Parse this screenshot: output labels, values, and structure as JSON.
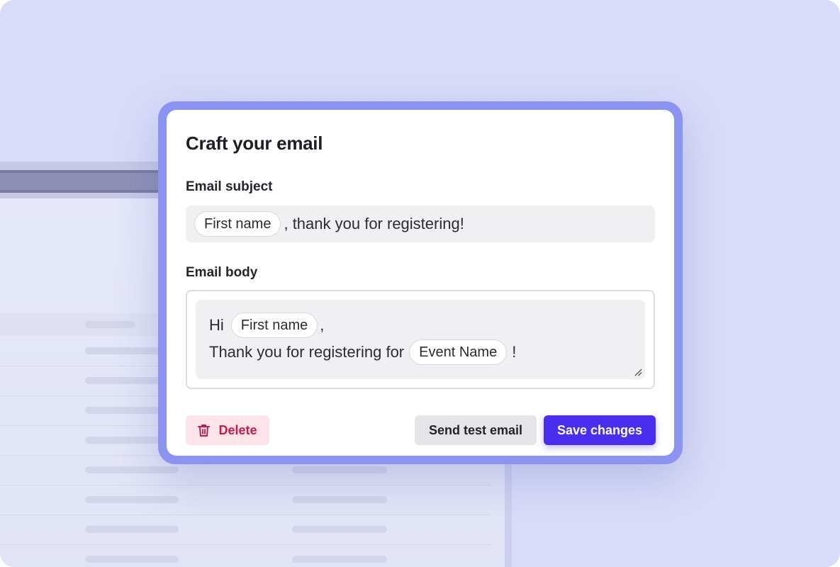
{
  "modal": {
    "title": "Craft your email",
    "subject": {
      "label": "Email subject",
      "token": "First name",
      "text_after_token": ", thank you for registering!"
    },
    "body": {
      "label": "Email body",
      "line1_prefix": "Hi",
      "line1_token": "First name",
      "line1_suffix": ",",
      "line2_prefix": "Thank you for registering for",
      "line2_token": "Event Name",
      "line2_suffix": "!"
    },
    "buttons": {
      "delete": "Delete",
      "send_test": "Send test email",
      "save": "Save changes"
    }
  },
  "colors": {
    "backdrop": "#d9dcf8",
    "modal_frame": "#8b95f1",
    "primary": "#4a2ef0",
    "danger": "#c21c4a",
    "danger_bg": "#fde4ea"
  },
  "icons": {
    "delete": "trash-icon",
    "resize": "resize-grip-icon"
  }
}
